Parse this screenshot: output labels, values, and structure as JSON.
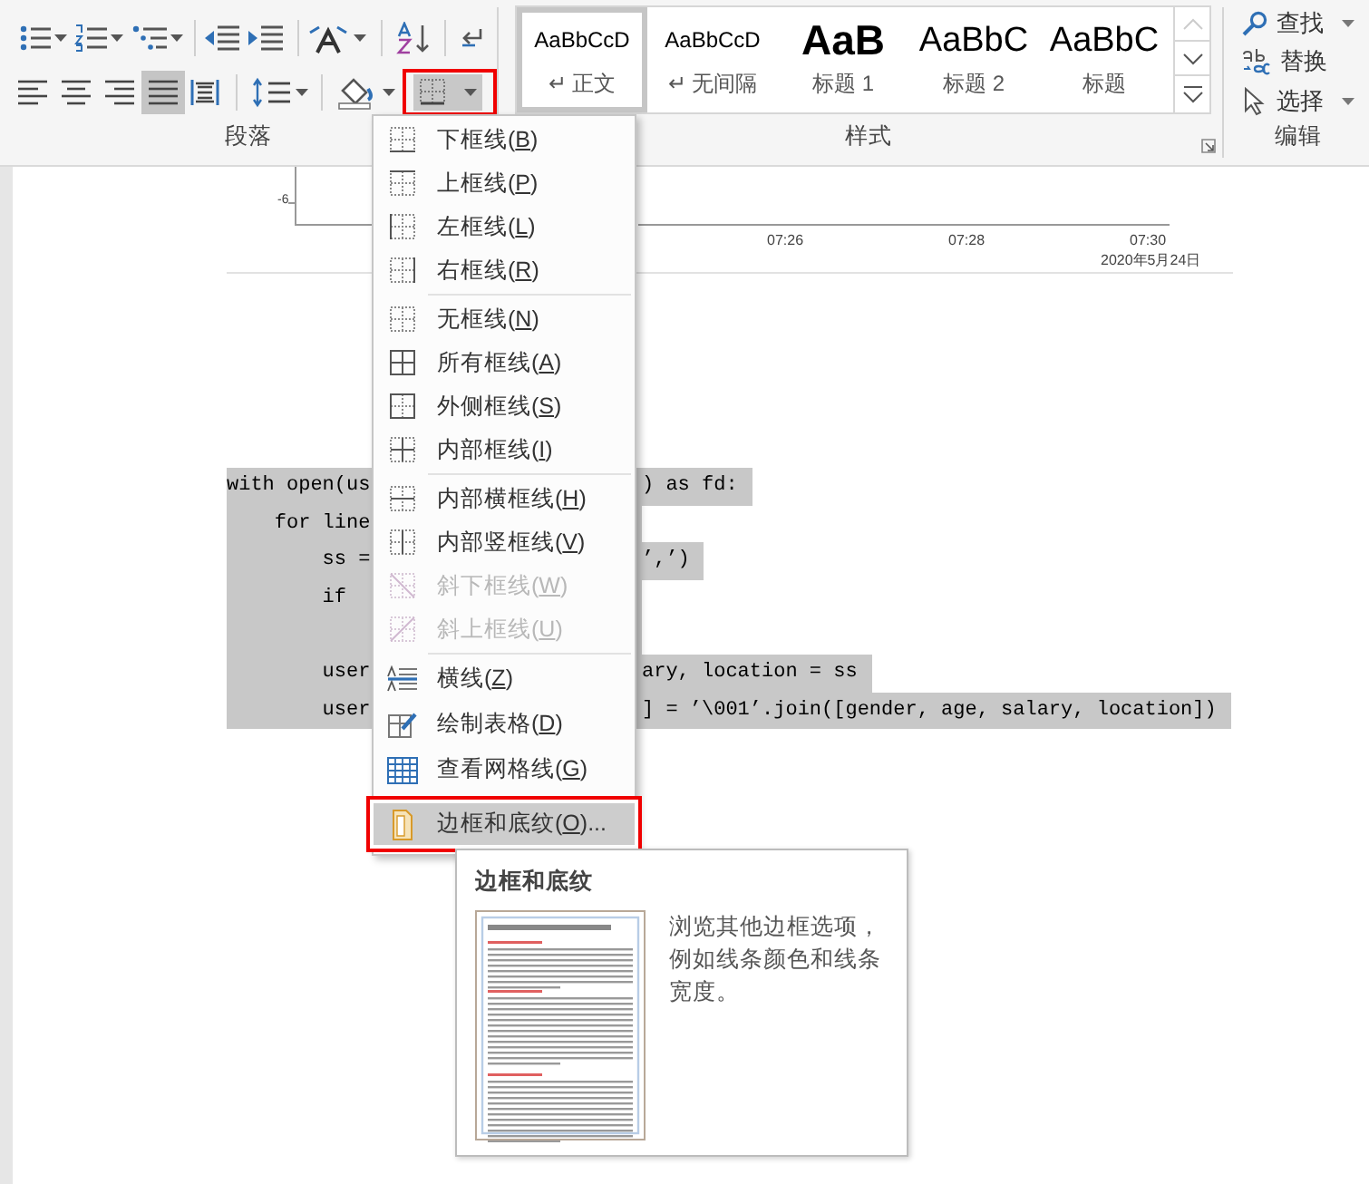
{
  "ribbon": {
    "paragraph": {
      "label": "段落",
      "alignment": [
        {
          "selected": false
        },
        {
          "selected": false
        },
        {
          "selected": false
        },
        {
          "selected": true
        },
        {
          "selected": false
        }
      ],
      "borders_button": {
        "annotated": true
      }
    },
    "styles": {
      "label": "样式",
      "items": [
        {
          "kind": "normal",
          "preview": "AaBbCcD",
          "name": "↵ 正文",
          "selected": true
        },
        {
          "kind": "no_spacing",
          "preview": "AaBbCcD",
          "name": "↵ 无间隔",
          "selected": false
        },
        {
          "kind": "heading1",
          "preview": "AaB",
          "name": "标题 1",
          "selected": false
        },
        {
          "kind": "heading2",
          "preview": "AaBbC",
          "name": "标题 2",
          "selected": false
        },
        {
          "kind": "title",
          "preview": "AaBbC",
          "name": "标题",
          "selected": false
        }
      ]
    },
    "editing": {
      "label": "编辑",
      "commands": [
        {
          "kind": "find",
          "label": "查找",
          "dropdown": true
        },
        {
          "kind": "replace",
          "label": "替换",
          "dropdown": false
        },
        {
          "kind": "select",
          "label": "选择",
          "dropdown": true
        }
      ]
    }
  },
  "document": {
    "chart_axis": {
      "y_tick": "-6",
      "x_ticks": [
        "07:26",
        "07:28",
        "07:30"
      ],
      "date": "2020年5月24日"
    },
    "code_lines": [
      {
        "kind": "text",
        "start": "with open(us",
        "end": ") as fd:"
      },
      {
        "kind": "text",
        "start": "    for line"
      },
      {
        "kind": "text",
        "start": "        ss =",
        "end": "’,’)"
      },
      {
        "kind": "text",
        "start": "        if"
      },
      {
        "kind": "blank"
      },
      {
        "kind": "text",
        "start": "        user",
        "end": "ary, location = ss"
      },
      {
        "kind": "text",
        "start": "        user",
        "end": "] = ’\\001’.join([gender, age, salary, location])"
      }
    ]
  },
  "borders_menu": {
    "groups": [
      {
        "items": [
          {
            "kind": "bottom",
            "text": "下框线(",
            "key": "B",
            "after": ")",
            "disabled": false,
            "highlighted": false,
            "annotated": false
          },
          {
            "kind": "top",
            "text": "上框线(",
            "key": "P",
            "after": ")",
            "disabled": false,
            "highlighted": false,
            "annotated": false
          },
          {
            "kind": "left",
            "text": "左框线(",
            "key": "L",
            "after": ")",
            "disabled": false,
            "highlighted": false,
            "annotated": false
          },
          {
            "kind": "right",
            "text": "右框线(",
            "key": "R",
            "after": ")",
            "disabled": false,
            "highlighted": false,
            "annotated": false
          }
        ]
      },
      {
        "items": [
          {
            "kind": "none",
            "text": "无框线(",
            "key": "N",
            "after": ")",
            "disabled": false,
            "highlighted": false,
            "annotated": false
          },
          {
            "kind": "all",
            "text": "所有框线(",
            "key": "A",
            "after": ")",
            "disabled": false,
            "highlighted": false,
            "annotated": false
          },
          {
            "kind": "outside",
            "text": "外侧框线(",
            "key": "S",
            "after": ")",
            "disabled": false,
            "highlighted": false,
            "annotated": false
          },
          {
            "kind": "inside",
            "text": "内部框线(",
            "key": "I",
            "after": ")",
            "disabled": false,
            "highlighted": false,
            "annotated": false
          }
        ]
      },
      {
        "items": [
          {
            "kind": "inside_h",
            "text": "内部横框线(",
            "key": "H",
            "after": ")",
            "disabled": false,
            "highlighted": false,
            "annotated": false
          },
          {
            "kind": "inside_v",
            "text": "内部竖框线(",
            "key": "V",
            "after": ")",
            "disabled": false,
            "highlighted": false,
            "annotated": false
          },
          {
            "kind": "diag_down",
            "text": "斜下框线(",
            "key": "W",
            "after": ")",
            "disabled": true,
            "highlighted": false,
            "annotated": false
          },
          {
            "kind": "diag_up",
            "text": "斜上框线(",
            "key": "U",
            "after": ")",
            "disabled": true,
            "highlighted": false,
            "annotated": false
          }
        ]
      },
      {
        "items": [
          {
            "kind": "hline",
            "text": "横线(",
            "key": "Z",
            "after": ")",
            "disabled": false,
            "highlighted": false,
            "annotated": false
          },
          {
            "kind": "draw",
            "text": "绘制表格(",
            "key": "D",
            "after": ")",
            "disabled": false,
            "highlighted": false,
            "annotated": false
          },
          {
            "kind": "grid",
            "text": "查看网格线(",
            "key": "G",
            "after": ")",
            "disabled": false,
            "highlighted": false,
            "annotated": false
          },
          {
            "kind": "dialog",
            "text": "边框和底纹(",
            "key": "O",
            "after": ")...",
            "disabled": false,
            "highlighted": true,
            "annotated": true
          }
        ]
      }
    ]
  },
  "tooltip": {
    "title": "边框和底纹",
    "description": "浏览其他边框选项，例如线条颜色和线条宽度。"
  }
}
